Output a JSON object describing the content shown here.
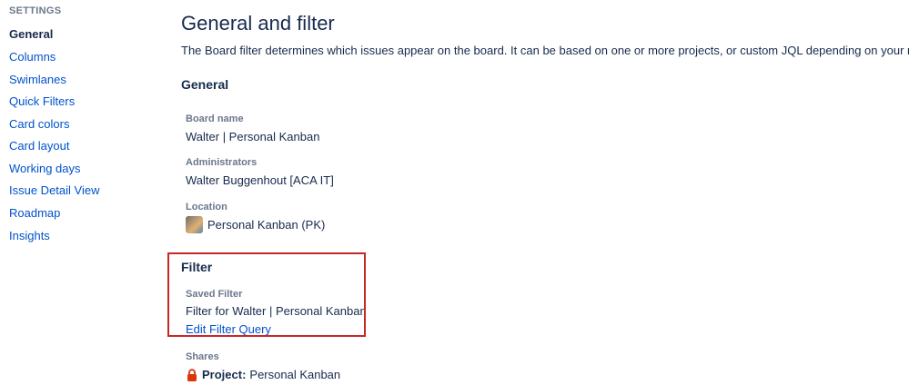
{
  "sidebar": {
    "heading": "SETTINGS",
    "items": [
      {
        "label": "General",
        "active": true
      },
      {
        "label": "Columns"
      },
      {
        "label": "Swimlanes"
      },
      {
        "label": "Quick Filters"
      },
      {
        "label": "Card colors"
      },
      {
        "label": "Card layout"
      },
      {
        "label": "Working days"
      },
      {
        "label": "Issue Detail View"
      },
      {
        "label": "Roadmap"
      },
      {
        "label": "Insights"
      }
    ]
  },
  "main": {
    "title": "General and filter",
    "description": "The Board filter determines which issues appear on the board. It can be based on one or more projects, or custom JQL depending on your needs.",
    "general": {
      "title": "General",
      "board_name_label": "Board name",
      "board_name_value": "Walter | Personal Kanban",
      "administrators_label": "Administrators",
      "administrators_value": "Walter Buggenhout [ACA IT]",
      "location_label": "Location",
      "location_value": "Personal Kanban (PK)"
    },
    "filter": {
      "title": "Filter",
      "saved_filter_label": "Saved Filter",
      "saved_filter_value": "Filter for Walter | Personal Kanban",
      "edit_link": "Edit Filter Query",
      "shares_label": "Shares",
      "shares_type": "Project:",
      "shares_value": "Personal Kanban"
    }
  },
  "colors": {
    "link": "#0052cc",
    "highlight": "#c62828",
    "lock": "#de350b"
  },
  "icons": {
    "project_avatar": "project-avatar-icon",
    "lock": "lock-icon"
  }
}
